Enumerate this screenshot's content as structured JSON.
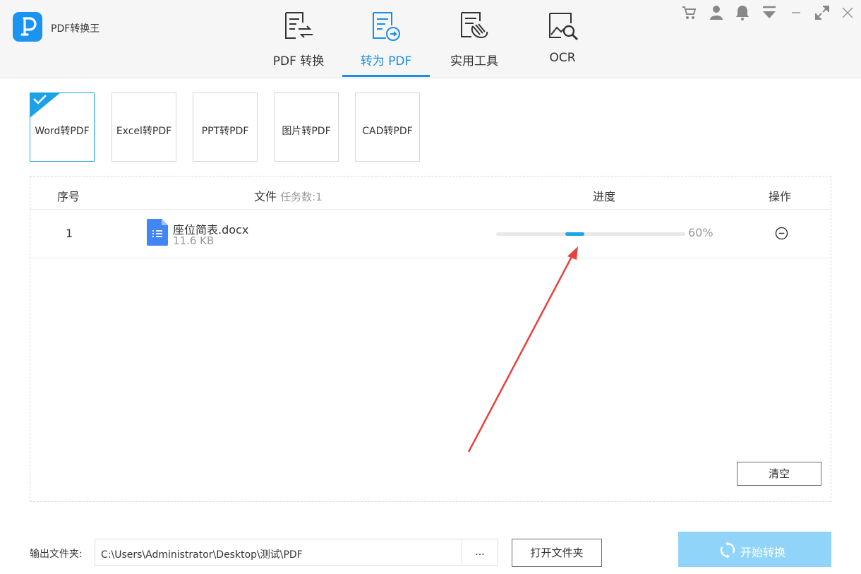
{
  "app": {
    "title": "PDF转换王"
  },
  "tabs": [
    {
      "label": "PDF 转换",
      "icon": "document-convert-icon"
    },
    {
      "label": "转为 PDF",
      "icon": "document-to-pdf-icon",
      "active": true
    },
    {
      "label": "实用工具",
      "icon": "tools-hand-icon"
    },
    {
      "label": "OCR",
      "icon": "image-search-icon"
    }
  ],
  "window_controls": [
    "cart-icon",
    "user-icon",
    "bell-icon",
    "menu-dropdown-icon",
    "minimize-icon",
    "maximize-icon",
    "close-icon"
  ],
  "formats": [
    {
      "label": "Word转PDF",
      "selected": true
    },
    {
      "label": "Excel转PDF"
    },
    {
      "label": "PPT转PDF"
    },
    {
      "label": "图片转PDF"
    },
    {
      "label": "CAD转PDF"
    }
  ],
  "table": {
    "headers": {
      "index": "序号",
      "file": "文件",
      "task_count": "任务数:1",
      "progress": "进度",
      "actions": "操作"
    },
    "rows": [
      {
        "index": "1",
        "name": "座位简表.docx",
        "size": "11.6 KB",
        "progress_percent": 60,
        "progress_text": "60%"
      }
    ],
    "clear_label": "清空"
  },
  "output": {
    "label": "输出文件夹:",
    "path": "C:\\Users\\Administrator\\Desktop\\测试\\PDF",
    "browse_label": "...",
    "open_folder_label": "打开文件夹",
    "start_label": "开始转换"
  },
  "colors": {
    "accent": "#1a8fe6",
    "start_button": "#90d5f9",
    "progress_fill": "#1ba5e8",
    "annotation_arrow": "#e8413c"
  }
}
